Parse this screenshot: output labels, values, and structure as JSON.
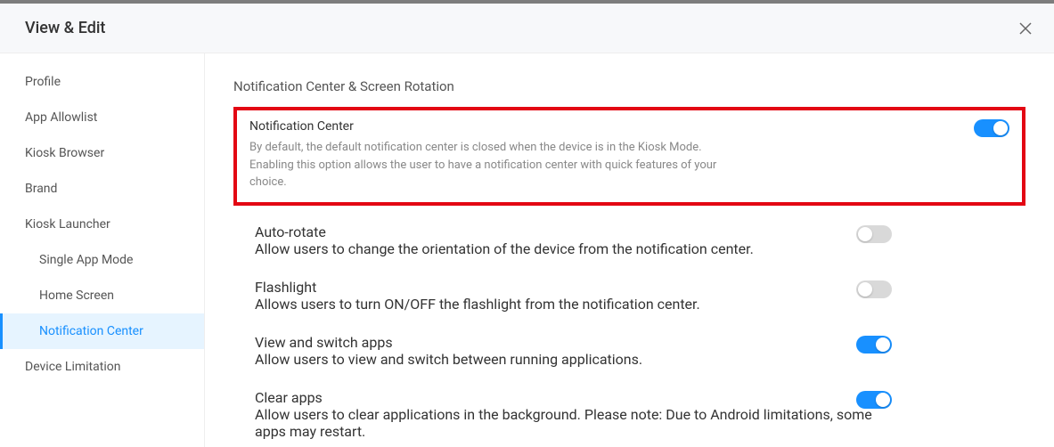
{
  "header": {
    "title": "View & Edit"
  },
  "sidebar": {
    "items": [
      {
        "label": "Profile"
      },
      {
        "label": "App Allowlist"
      },
      {
        "label": "Kiosk Browser"
      },
      {
        "label": "Brand"
      },
      {
        "label": "Kiosk Launcher"
      },
      {
        "label": "Single App Mode"
      },
      {
        "label": "Home Screen"
      },
      {
        "label": "Notification Center"
      },
      {
        "label": "Device Limitation"
      }
    ]
  },
  "content": {
    "section_title": "Notification Center & Screen Rotation",
    "notification_center": {
      "title": "Notification Center",
      "desc": "By default, the default notification center is closed when the device is in the Kiosk Mode. Enabling this option allows the user to have a notification center with quick features of your choice.",
      "on": true
    },
    "auto_rotate": {
      "title": "Auto-rotate",
      "desc": "Allow users to change the orientation of the device from the notification center.",
      "on": false
    },
    "flashlight": {
      "title": "Flashlight",
      "desc": "Allows users to turn ON/OFF the flashlight from the notification center.",
      "on": false
    },
    "view_switch": {
      "title": "View and switch apps",
      "desc": "Allow users to view and switch between running applications.",
      "on": true
    },
    "clear_apps": {
      "title": "Clear apps",
      "desc": "Allow users to clear applications in the background. Please note: Due to Android limitations, some apps may restart.",
      "on": true
    }
  }
}
